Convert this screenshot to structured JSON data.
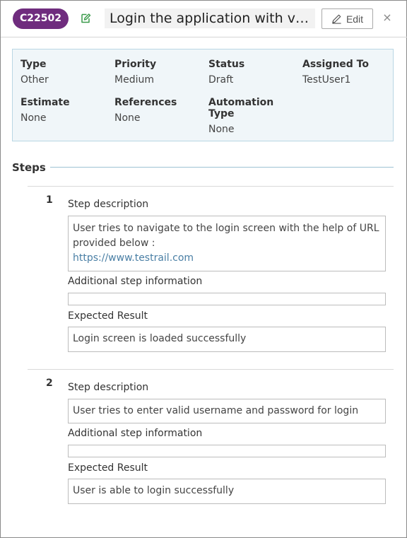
{
  "header": {
    "case_id": "C22502",
    "title": "Login the application with valid credentials",
    "edit_label": "Edit",
    "close_label": "×"
  },
  "info": {
    "type_label": "Type",
    "type_value": "Other",
    "priority_label": "Priority",
    "priority_value": "Medium",
    "status_label": "Status",
    "status_value": "Draft",
    "assigned_label": "Assigned To",
    "assigned_value": "TestUser1",
    "estimate_label": "Estimate",
    "estimate_value": "None",
    "references_label": "References",
    "references_value": "None",
    "automation_label_1": "Automation",
    "automation_label_2": "Type",
    "automation_value": "None"
  },
  "steps": {
    "title": "Steps",
    "items": [
      {
        "number": "1",
        "desc_label": "Step description",
        "desc_line1": "User tries to navigate to the login screen with the help of URL",
        "desc_line2": "provided below :",
        "desc_link": "https://www.testrail.com",
        "add_label": "Additional step information",
        "add_value": "",
        "exp_label": "Expected Result",
        "exp_value": "Login screen is loaded successfully"
      },
      {
        "number": "2",
        "desc_label": "Step description",
        "desc_line1": "User tries to enter valid username and password for login",
        "add_label": "Additional step information",
        "add_value": "",
        "exp_label": "Expected Result",
        "exp_value": "User is able to login successfully"
      }
    ]
  },
  "colors": {
    "badge": "#6f2c7e",
    "info_bg": "#f0f6f9",
    "info_border": "#b9d7e4",
    "link": "#4a7fa5"
  },
  "icons": {
    "edit_title": "pencil-note-icon",
    "edit_button": "pencil-icon",
    "close": "close-icon"
  }
}
